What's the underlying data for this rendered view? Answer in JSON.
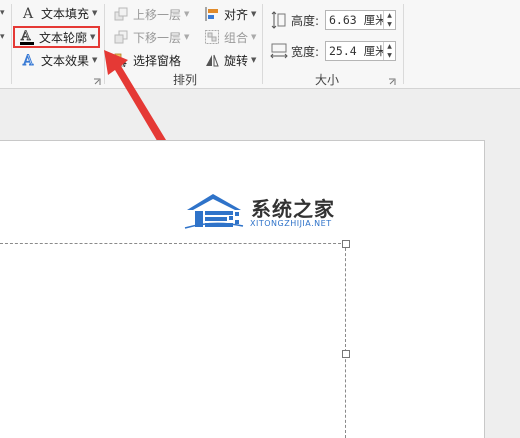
{
  "ribbon": {
    "text_fill": "文本填充",
    "text_outline": "文本轮廓",
    "text_effect": "文本效果",
    "bring_forward": "上移一层",
    "send_backward": "下移一层",
    "selection_pane": "选择窗格",
    "align": "对齐",
    "group": "组合",
    "rotate": "旋转",
    "arrange_group": "排列",
    "height_label": "高度:",
    "height_value": "6.63 厘米",
    "width_label": "宽度:",
    "width_value": "25.4 厘米",
    "size_group": "大小"
  },
  "watermark": {
    "title": "系统之家",
    "subtitle": "XITONGZHIJIA.NET"
  },
  "colors": {
    "highlight": "#e53935",
    "arrow": "#e53935",
    "logo_blue": "#2f73c9"
  }
}
